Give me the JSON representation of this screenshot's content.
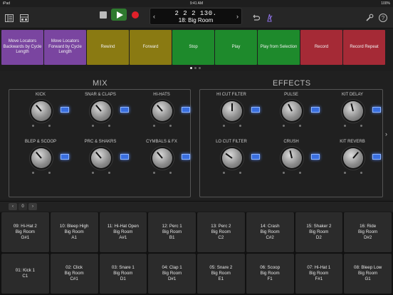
{
  "status": {
    "device": "iPad",
    "time": "9:41 AM",
    "battery": "100%"
  },
  "toolbar": {
    "icons": [
      "library-icon",
      "mixer-icon",
      "cycle-icon",
      "metronome-icon",
      "wrench-icon",
      "help-icon"
    ],
    "help_glyph": "?"
  },
  "lcd": {
    "position": "2 2 2 130.",
    "name": "18: Big Room",
    "prev": "‹",
    "next": "›"
  },
  "commands": [
    {
      "label": "Move Locators Backwards by Cycle Length",
      "color": "#7a45a0"
    },
    {
      "label": "Move Locators Forward by Cycle Length",
      "color": "#7a45a0"
    },
    {
      "label": "Rewind",
      "color": "#8a7a12"
    },
    {
      "label": "Forward",
      "color": "#8a7a12"
    },
    {
      "label": "Stop",
      "color": "#1e8a2c"
    },
    {
      "label": "Play",
      "color": "#1e8a2c"
    },
    {
      "label": "Play from Selection",
      "color": "#1e8a2c"
    },
    {
      "label": "Record",
      "color": "#a52a36"
    },
    {
      "label": "Record Repeat",
      "color": "#a52a36"
    }
  ],
  "mix": {
    "title": "MIX",
    "knobs": [
      {
        "label": "KICK",
        "level": 0.35
      },
      {
        "label": "SNAR & CLAPS",
        "level": 0.35
      },
      {
        "label": "HI-HATS",
        "level": 0.35
      },
      {
        "label": "BLEP & SCOOP",
        "level": 0.35
      },
      {
        "label": "PRC & SHAKRS",
        "level": 0.35
      },
      {
        "label": "CYMBALS & FX",
        "level": 0.35
      }
    ]
  },
  "effects": {
    "title": "EFFECTS",
    "knobs": [
      {
        "label": "HI CUT FILTER",
        "level": 0.5
      },
      {
        "label": "PULSE",
        "level": 0.4
      },
      {
        "label": "KIT DELAY",
        "level": 0.45
      },
      {
        "label": "LO CUT FILTER",
        "level": 0.3
      },
      {
        "label": "CRUSH",
        "level": 0.45
      },
      {
        "label": "KIT REVERB",
        "level": 0.65
      }
    ]
  },
  "bank": {
    "prev": "‹",
    "value": "0",
    "next": "›"
  },
  "side_arrow": "›",
  "pads": [
    {
      "name": "09: Hi-Hat 2",
      "kit": "Big Room",
      "note": "G#1"
    },
    {
      "name": "10: Bleep High",
      "kit": "Big Room",
      "note": "A1"
    },
    {
      "name": "11: Hi-Hat Open",
      "kit": "Big Room",
      "note": "A#1"
    },
    {
      "name": "12: Perc 1",
      "kit": "Big Room",
      "note": "B1"
    },
    {
      "name": "13: Perc 2",
      "kit": "Big Room",
      "note": "C2"
    },
    {
      "name": "14: Crash",
      "kit": "Big Room",
      "note": "C#2"
    },
    {
      "name": "15: Shaker 2",
      "kit": "Big Room",
      "note": "D2"
    },
    {
      "name": "16: Ride",
      "kit": "Big Room",
      "note": "D#2"
    },
    {
      "name": "01: Kick 1",
      "kit": "",
      "note": "C1"
    },
    {
      "name": "02: Click",
      "kit": "Big Room",
      "note": "C#1"
    },
    {
      "name": "03: Snare 1",
      "kit": "Big Room",
      "note": "D1"
    },
    {
      "name": "04: Clap 1",
      "kit": "Big Room",
      "note": "D#1"
    },
    {
      "name": "05: Snare 2",
      "kit": "Big Room",
      "note": "E1"
    },
    {
      "name": "06: Scoop",
      "kit": "Big Room",
      "note": "F1"
    },
    {
      "name": "07: Hi-Hat 1",
      "kit": "Big Room",
      "note": "F#1"
    },
    {
      "name": "08: Bleep Low",
      "kit": "Big Room",
      "note": "G1"
    }
  ]
}
